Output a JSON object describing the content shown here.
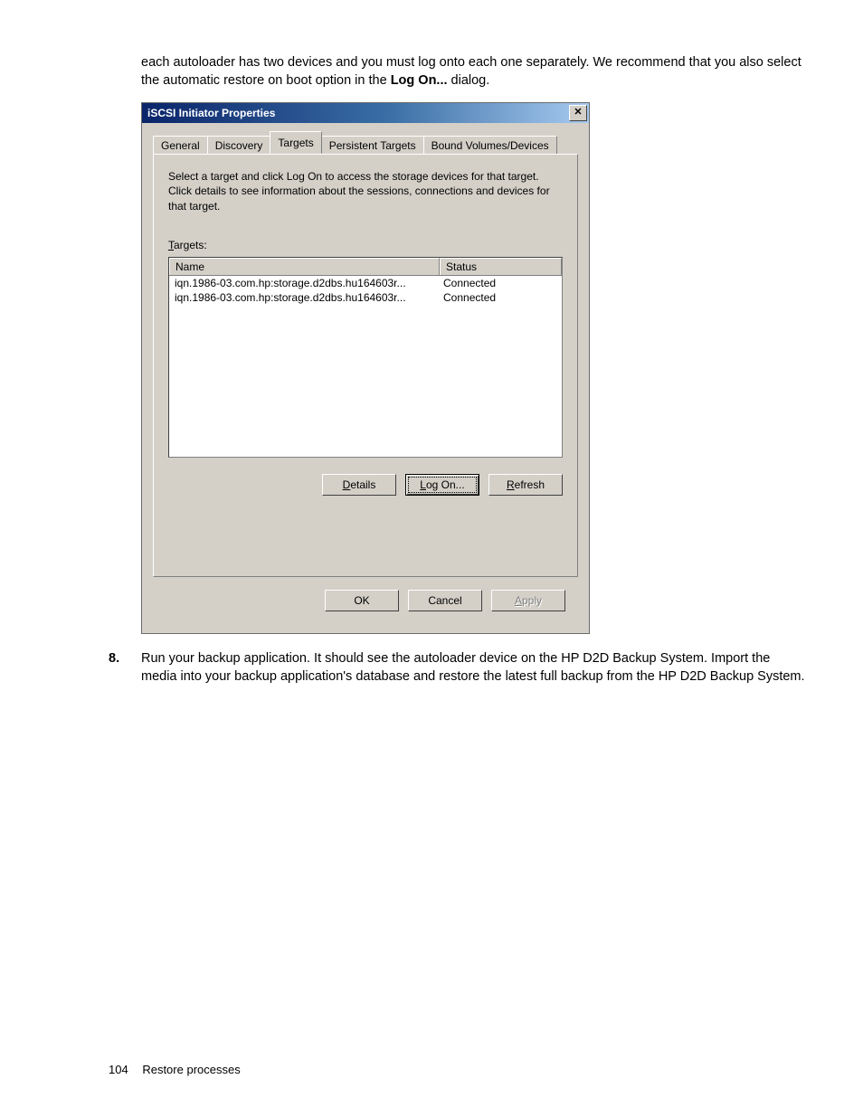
{
  "intro": {
    "line1_a": "each autoloader has two devices and you must log onto each one separately. We recommend that you also select the automatic restore on boot option in the ",
    "line1_bold": "Log On...",
    "line1_b": " dialog."
  },
  "dialog": {
    "title": "iSCSI Initiator Properties",
    "close_glyph": "✕",
    "tabs": {
      "general": "General",
      "discovery": "Discovery",
      "targets": "Targets",
      "persistent": "Persistent Targets",
      "bound": "Bound Volumes/Devices"
    },
    "instruction": "Select a target and click Log On to access the storage devices for that target. Click details to see information about the sessions, connections and devices for that target.",
    "targets_label_underline": "T",
    "targets_label_rest": "argets:",
    "columns": {
      "name": "Name",
      "status": "Status"
    },
    "rows": [
      {
        "name": "iqn.1986-03.com.hp:storage.d2dbs.hu164603r...",
        "status": "Connected"
      },
      {
        "name": "iqn.1986-03.com.hp:storage.d2dbs.hu164603r...",
        "status": "Connected"
      }
    ],
    "buttons": {
      "details_u": "D",
      "details_rest": "etails",
      "logon_u": "L",
      "logon_rest": "og On...",
      "refresh_pre": "",
      "refresh_u": "R",
      "refresh_rest": "efresh",
      "ok": "OK",
      "cancel": "Cancel",
      "apply_u": "A",
      "apply_rest": "pply"
    }
  },
  "step8": {
    "num": "8.",
    "text": "Run your backup application. It should see the autoloader device on the HP D2D Backup System. Import the media into your backup application's database and restore the latest full backup from the HP D2D Backup System."
  },
  "footer": {
    "page": "104",
    "section": "Restore processes"
  }
}
